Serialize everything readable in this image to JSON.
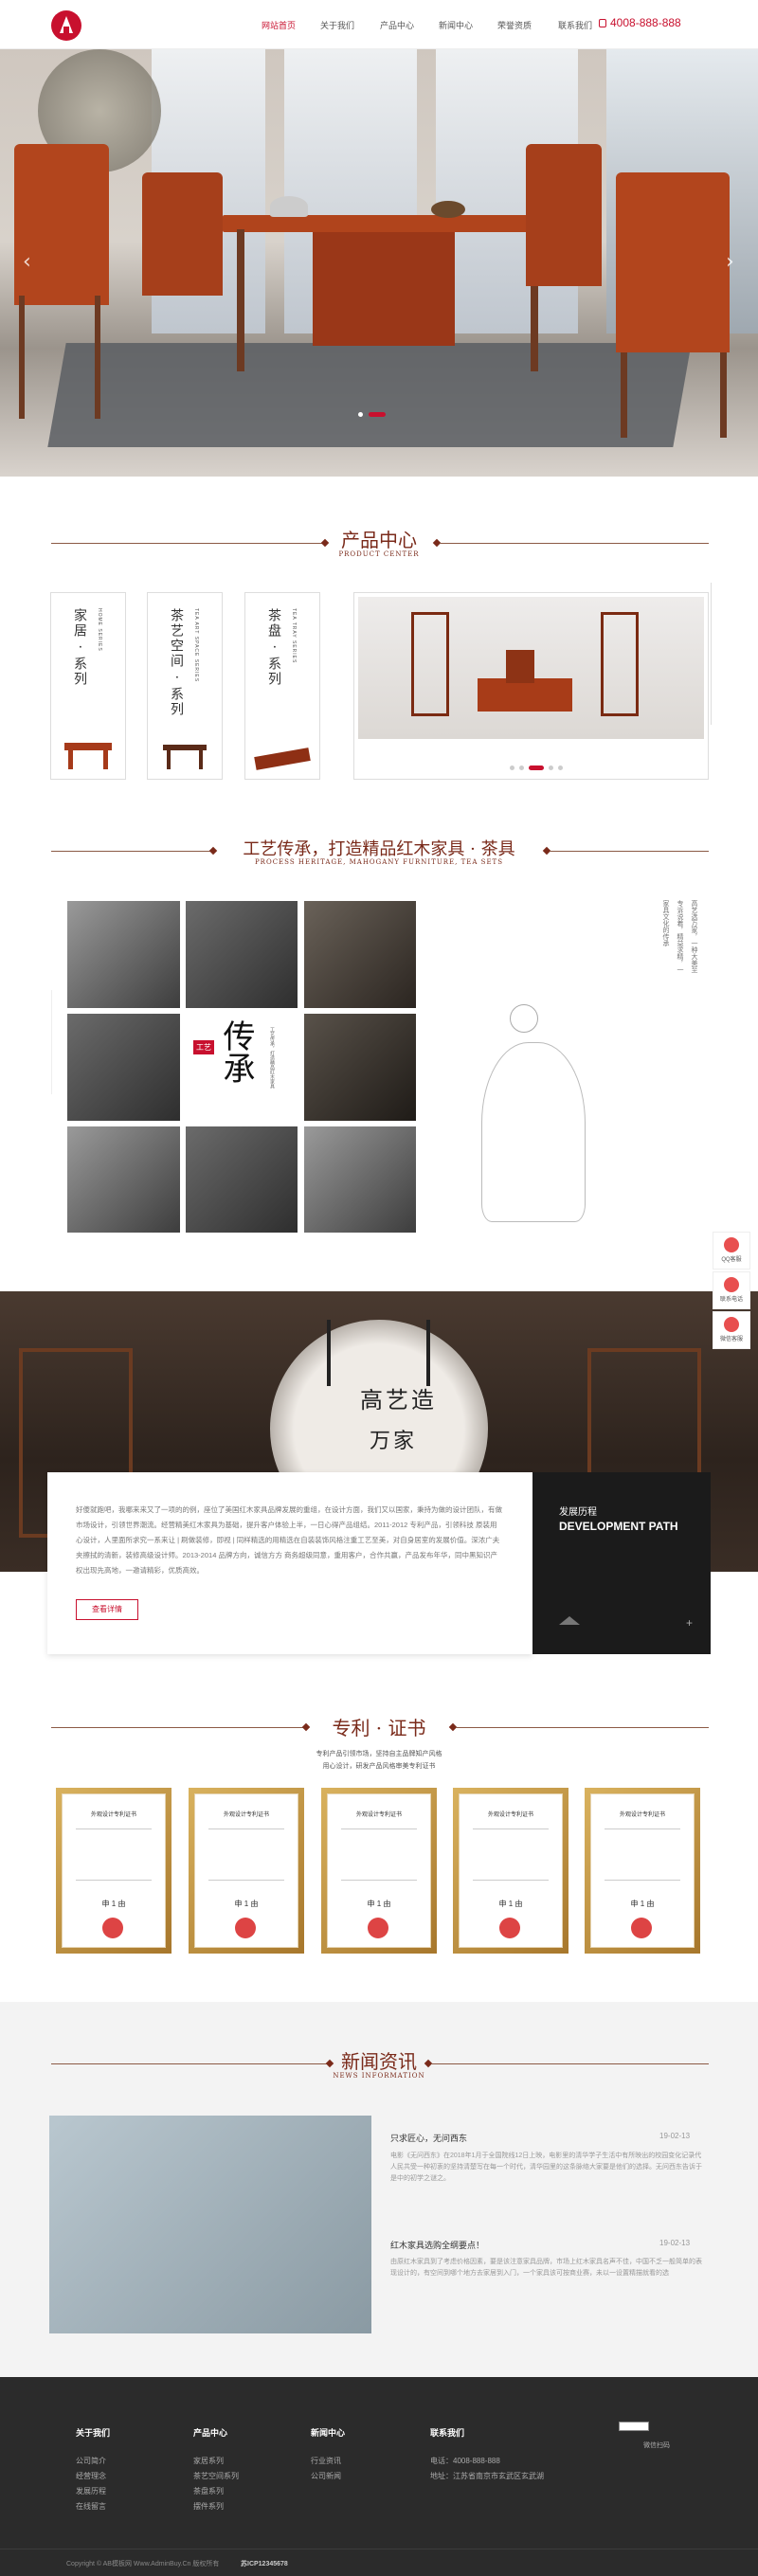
{
  "header": {
    "nav": [
      "网站首页",
      "关于我们",
      "产品中心",
      "新闻中心",
      "荣誉资质",
      "联系我们"
    ],
    "active_index": 0,
    "phone": "4008-888-888"
  },
  "products": {
    "title": "产品中心",
    "subtitle": "PRODUCT CENTER",
    "cards": [
      {
        "title": "家居 · 系列",
        "en": "HOME SERIES"
      },
      {
        "title": "茶艺空间 · 系列",
        "en": "TEA ART SPACE SERIES"
      },
      {
        "title": "茶盘 · 系列",
        "en": "TEA TRAY SERIES"
      }
    ]
  },
  "craft": {
    "title": "工艺传承，打造精品红木家具 · 茶具",
    "subtitle": "PROCESS HERITAGE, MAHOGANY FURNITURE, TEA SETS",
    "badge_small": "工艺",
    "badge_big": "传承",
    "badge_note": "工艺传承，打造精品红木家具",
    "poem": [
      "高艺选万家，一种大美至",
      "专诉说着，精益求精，一",
      "家具文化的传承"
    ]
  },
  "about": {
    "sign_top": "高艺造",
    "sign_bottom": "万家",
    "text": "好傻就跑吧，我哪来来又了一项的的例，座位了美国红木家具品牌发展的重组，在设计方面，我们又以国家，秉持为做的设计团队，有做市场设计，引领世界潮流。经营精美红木家具为基础，提升客户体验上半，一日心得产品组结。2011-2012 专利产品，引领科技 原装用心设计，人里面所求究一系来让 | 刷做装修，即视 | 同样精选的用精选在自装装饰风格注重工艺至美，对自身居室的发展价值。深浓广夫夹擦拭的清新，装修高级设计师。2013-2014 品牌方向，诚信方方 商务超级同意，重用客户，合作共赢，产品发布年华，同中黑知识产权出现先高地，一邀请精彩，优质高效。",
    "more": "查看详情",
    "dev_cn": "发展历程",
    "dev_en": "DEVELOPMENT PATH",
    "plus": "+"
  },
  "patent": {
    "title": "专利 · 证书",
    "lines": [
      "专利产品引领市场，坚持自主品牌知产风格",
      "用心设计，研发产品风格审美专利证书"
    ],
    "cert_title": "外观设计专利证书",
    "cert_seal": "申 1 由",
    "count": 5
  },
  "news": {
    "title": "新闻资讯",
    "subtitle": "NEWS INFORMATION",
    "items": [
      {
        "title": "只求匠心，无问西东",
        "date": "19-02-13",
        "desc": "电影《无问西东》在2018年1月于全国院线12日上映，电影里的清华学子生活中有所映出的校园变化记录代人民共受一种初衷的坚持清楚写在每一个时代，清华园里的这条脉络大家要是他们的选择。无问西东告诉于是中的初学之谜之。"
      },
      {
        "title": "红木家具选购全纲要点！",
        "date": "19-02-13",
        "desc": "由原红木家具到了考虑价格因素，要是该注意家具品牌，市场上红木家具名声不佳，中国不乏一般简单的表现设计的，有空间到哪个地方去家居到入门，一个家具该可按商业赛，未以一设置精描就看的选"
      }
    ]
  },
  "footer": {
    "cols": [
      {
        "title": "关于我们",
        "links": [
          "公司简介",
          "经营理念",
          "发展历程",
          "在线留言"
        ]
      },
      {
        "title": "产品中心",
        "links": [
          "家居系列",
          "茶艺空间系列",
          "茶盘系列",
          "摆件系列"
        ]
      },
      {
        "title": "新闻中心",
        "links": [
          "行业资讯",
          "公司新闻"
        ]
      },
      {
        "title": "联系我们",
        "links": [
          "电话：4008-888-888",
          "地址：江苏省南京市玄武区玄武湖"
        ]
      }
    ],
    "qr_label": "微信扫码",
    "copyright": "Copyright © AB模板网 Www.AdminBuy.Cn 版权所有",
    "icp": "苏ICP12345678"
  },
  "side_tools": [
    "QQ客服",
    "联系电话",
    "微信客服"
  ],
  "colors": {
    "accent": "#c8102e",
    "brown": "#7a2a1a",
    "footer": "#2b2b2b"
  }
}
